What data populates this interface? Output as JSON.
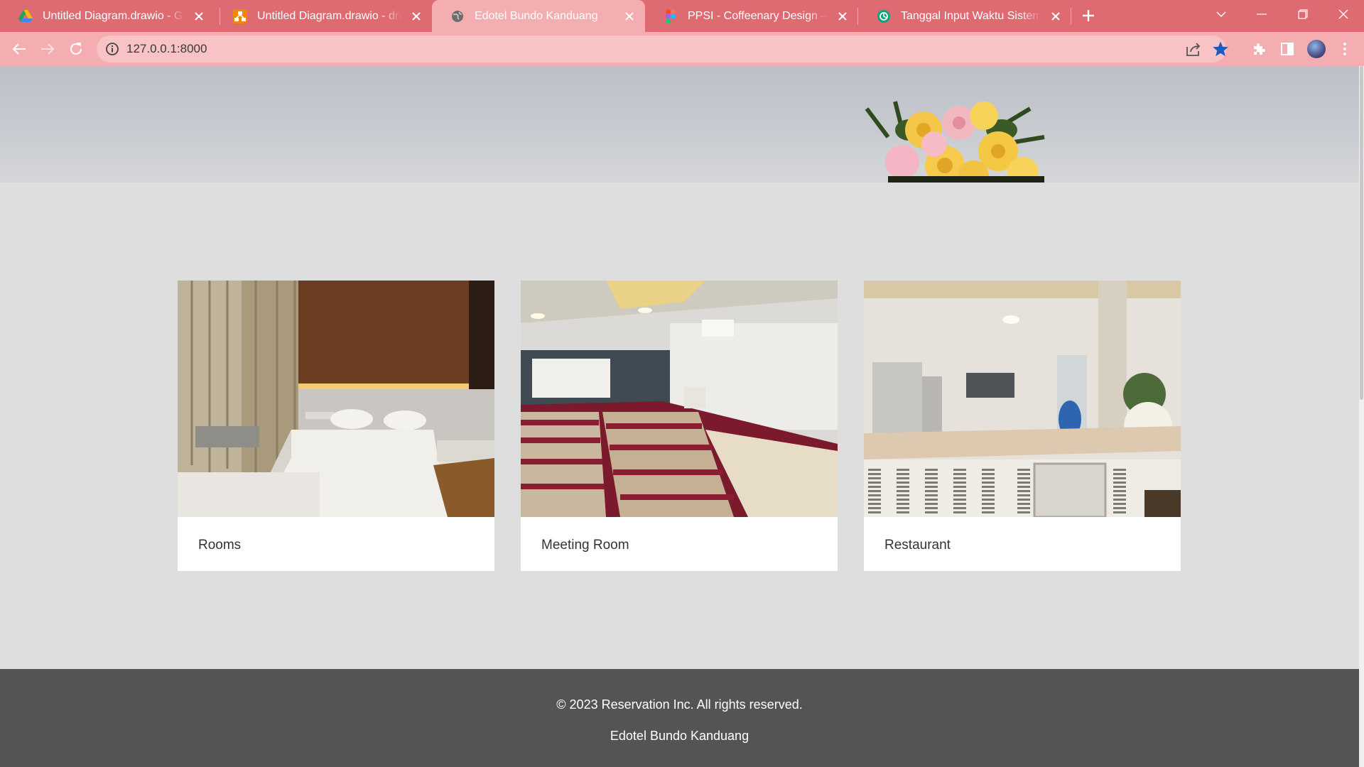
{
  "browser": {
    "tabs": [
      {
        "title": "Untitled Diagram.drawio - Google Drive",
        "icon": "google-drive-icon"
      },
      {
        "title": "Untitled Diagram.drawio - draw.io",
        "icon": "drawio-icon"
      },
      {
        "title": "Edotel Bundo Kanduang",
        "icon": "globe-icon",
        "active": true
      },
      {
        "title": "PPSI - Coffeenary Design – Figma",
        "icon": "figma-icon"
      },
      {
        "title": "Tanggal Input Waktu Sistem",
        "icon": "chatgpt-icon"
      }
    ],
    "url": "127.0.0.1:8000",
    "accent_color": "#de6a72",
    "toolbar_color": "#f4adb0"
  },
  "page": {
    "cards": [
      {
        "label": "Rooms",
        "photo": "hotel-bedroom-photo"
      },
      {
        "label": "Meeting Room",
        "photo": "meeting-room-photo"
      },
      {
        "label": "Restaurant",
        "photo": "restaurant-photo"
      }
    ],
    "footer": {
      "copyright": "© 2023 Reservation Inc. All rights reserved.",
      "brand": "Edotel Bundo Kanduang"
    }
  }
}
